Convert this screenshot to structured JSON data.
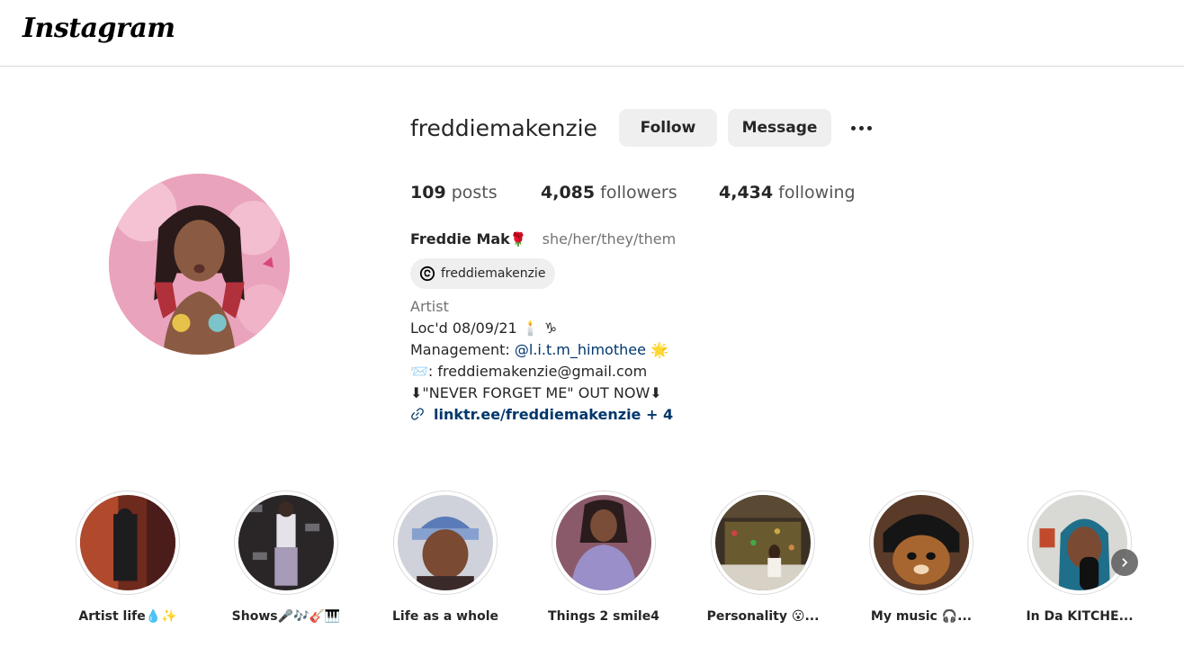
{
  "app": {
    "logo": "Instagram"
  },
  "profile": {
    "username": "freddiemakenzie",
    "follow_label": "Follow",
    "message_label": "Message",
    "stats": {
      "posts_count": "109",
      "posts_label": "posts",
      "followers_count": "4,085",
      "followers_label": "followers",
      "following_count": "4,434",
      "following_label": "following"
    },
    "full_name": "Freddie Mak",
    "full_name_emoji": "🌹",
    "pronouns": "she/her/they/them",
    "threads_handle": "freddiemakenzie",
    "category": "Artist",
    "bio": {
      "line1": "Loc'd 08/09/21 🕯️ ♑︎",
      "line2_prefix": "Management: ",
      "line2_mention": "@l.i.t.m_himothee",
      "line2_suffix": " 🌟",
      "line3": "📨: freddiemakenzie@gmail.com",
      "line4": "⬇\"NEVER FORGET ME\" OUT NOW⬇"
    },
    "link_text": "linktr.ee/freddiemakenzie + 4"
  },
  "highlights": [
    {
      "label": "Artist life💧✨",
      "color": "#8a3a2a"
    },
    {
      "label": "Shows🎤🎶🎸🎹",
      "color": "#2d2a30"
    },
    {
      "label": "Life as a whole",
      "color": "#9ba9c9"
    },
    {
      "label": "Things 2 smile4",
      "color": "#6c4a58"
    },
    {
      "label": "Personality 😮...",
      "color": "#4a3d2c"
    },
    {
      "label": "My music 🎧...",
      "color": "#3b2417"
    },
    {
      "label": "In Da KITCHE...",
      "color": "#c6c9c4"
    }
  ],
  "icons": {
    "more": "more-horizontal-icon",
    "threads": "threads-icon",
    "link": "link-icon",
    "next": "chevron-right-icon"
  }
}
